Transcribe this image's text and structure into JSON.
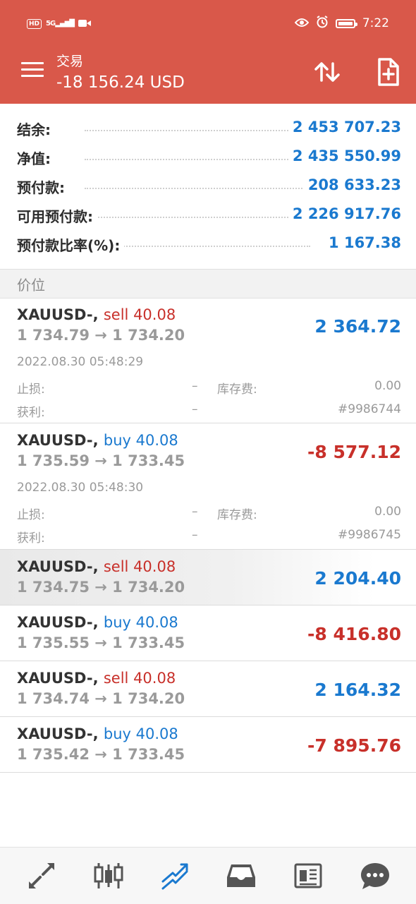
{
  "status_bar": {
    "time": "7:22",
    "hd": "HD",
    "network": "5G"
  },
  "header": {
    "title": "交易",
    "balance": "-18 156.24 USD"
  },
  "summary": [
    {
      "label": "结余:",
      "value": "2 453 707.23"
    },
    {
      "label": "净值:",
      "value": "2 435 550.99"
    },
    {
      "label": "预付款:",
      "value": "208 633.23"
    },
    {
      "label": "可用预付款:",
      "value": "2 226 917.76"
    },
    {
      "label": "预付款比率(%):",
      "value": "1 167.38"
    }
  ],
  "section_title": "价位",
  "positions": [
    {
      "symbol": "XAUUSD-,",
      "side": "sell 40.08",
      "prices": "1 734.79 → 1 734.20",
      "profit": "2 364.72",
      "datetime": "2022.08.30 05:48:29",
      "sl_label": "止损:",
      "sl": "–",
      "swap_label": "库存费:",
      "swap": "0.00",
      "tp_label": "获利:",
      "tp": "–",
      "ticket": "#9986744"
    },
    {
      "symbol": "XAUUSD-,",
      "side": "buy 40.08",
      "prices": "1 735.59 → 1 733.45",
      "profit": "-8 577.12",
      "datetime": "2022.08.30 05:48:30",
      "sl_label": "止损:",
      "sl": "–",
      "swap_label": "库存费:",
      "swap": "0.00",
      "tp_label": "获利:",
      "tp": "–",
      "ticket": "#9986745"
    },
    {
      "symbol": "XAUUSD-,",
      "side": "sell 40.08",
      "prices": "1 734.75 → 1 734.20",
      "profit": "2 204.40"
    },
    {
      "symbol": "XAUUSD-,",
      "side": "buy 40.08",
      "prices": "1 735.55 → 1 733.45",
      "profit": "-8 416.80"
    },
    {
      "symbol": "XAUUSD-,",
      "side": "sell 40.08",
      "prices": "1 734.74 → 1 734.20",
      "profit": "2 164.32"
    },
    {
      "symbol": "XAUUSD-,",
      "side": "buy 40.08",
      "prices": "1 735.42 → 1 733.45",
      "profit": "-7 895.76"
    }
  ],
  "bottom_nav": [
    {
      "icon": "quotes-icon"
    },
    {
      "icon": "candlestick-chart-icon"
    },
    {
      "icon": "trade-icon",
      "active": true
    },
    {
      "icon": "history-inbox-icon"
    },
    {
      "icon": "news-icon"
    },
    {
      "icon": "messages-icon"
    }
  ],
  "colors": {
    "header": "#d9584a",
    "positive": "#1a79cf",
    "negative": "#c8302a",
    "active_nav": "#1a79cf"
  }
}
